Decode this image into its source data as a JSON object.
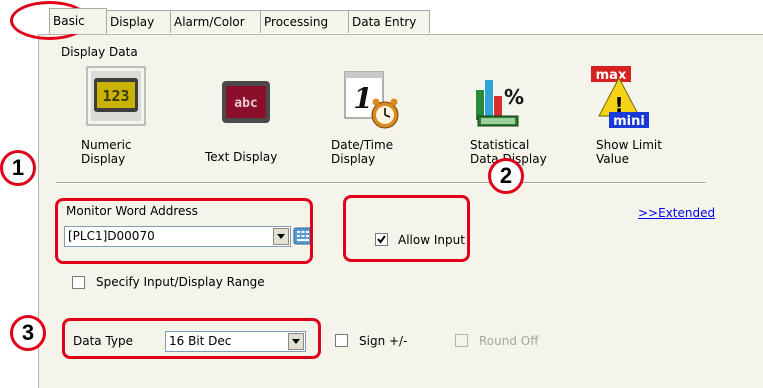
{
  "tabs": [
    {
      "label": "Basic"
    },
    {
      "label": "Display"
    },
    {
      "label": "Alarm/Color"
    },
    {
      "label": "Processing"
    },
    {
      "label": "Data Entry"
    }
  ],
  "display_data": {
    "heading": "Display Data",
    "items": [
      {
        "icon": "numeric-display-icon",
        "icon_text": "123",
        "line1": "Numeric",
        "line2": "Display"
      },
      {
        "icon": "text-display-icon",
        "icon_text": "abc",
        "line1": "Text Display",
        "line2": ""
      },
      {
        "icon": "date-time-display-icon",
        "icon_text": "1",
        "line1": "Date/Time",
        "line2": "Display"
      },
      {
        "icon": "statistical-display-icon",
        "icon_text": "%",
        "line1": "Statistical",
        "line2": "Data Display"
      },
      {
        "icon": "show-limit-value-icon",
        "icon_text_top": "max",
        "icon_text_bottom": "mini",
        "line1": "Show Limit",
        "line2": "Value"
      }
    ]
  },
  "monitor": {
    "label": "Monitor Word Address",
    "value": "[PLC1]D00070"
  },
  "extended_link": ">>Extended",
  "allow_input": {
    "label": "Allow Input",
    "checked": true
  },
  "specify_range": {
    "label": "Specify Input/Display Range",
    "checked": false
  },
  "data_type": {
    "label": "Data Type",
    "value": "16 Bit Dec"
  },
  "sign": {
    "label": "Sign +/-",
    "checked": false
  },
  "round_off": {
    "label": "Round Off",
    "checked": false,
    "enabled": false
  },
  "callouts": [
    "1",
    "2",
    "3"
  ],
  "colors": {
    "callout_red": "#e0001a",
    "panel_bg": "#f5f4ea",
    "link_blue": "#0000ee"
  }
}
